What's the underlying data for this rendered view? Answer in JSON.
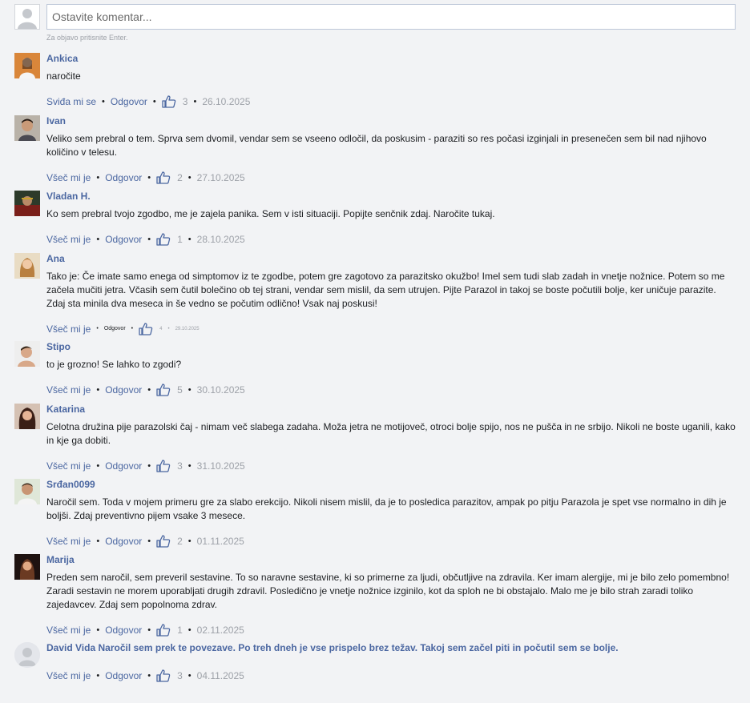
{
  "composer": {
    "placeholder": "Ostavite komentar...",
    "hint": "Za objavo pritisnite Enter."
  },
  "colors": {
    "link": "#4b67a1",
    "muted": "#9da1a8",
    "background": "#f2f3f5"
  },
  "comments": [
    {
      "name": "Ankica",
      "text": "naročite",
      "like_label": "Sviđa mi se",
      "reply_label": "Odgovor",
      "likes": "3",
      "date": "26.10.2025",
      "avatar": "woman-photo-icon"
    },
    {
      "name": "Ivan",
      "text": "Veliko sem prebral o tem. Sprva sem dvomil, vendar sem se vseeno odločil, da poskusim - paraziti so res počasi izginjali in presenečen sem bil nad njihovo količino v telesu.",
      "like_label": "Všeč mi je",
      "reply_label": "Odgovor",
      "likes": "2",
      "date": "27.10.2025",
      "avatar": "man-photo-icon"
    },
    {
      "name": "Vladan H.",
      "text": "Ko sem prebral tvojo zgodbo, me je zajela panika. Sem v isti situaciji. Popijte senčnik zdaj. Naročite tukaj.",
      "like_label": "Všeč mi je",
      "reply_label": "Odgovor",
      "likes": "1",
      "date": "28.10.2025",
      "avatar": "man-photo-icon"
    },
    {
      "name": "Ana",
      "text": "Tako je: Če imate samo enega od simptomov iz te zgodbe, potem gre zagotovo za parazitsko okužbo! Imel sem tudi slab zadah in vnetje nožnice. Potem so me začela mučiti jetra. Včasih sem čutil bolečino ob tej strani, vendar sem mislil, da sem utrujen. Pijte Parazol in takoj se boste počutili bolje, ker uničuje parazite. Zdaj sta minila dva meseca in še vedno se počutim odlično! Vsak naj poskusi!",
      "like_label": "Všeč mi je",
      "reply_label": "Odgovor",
      "likes": "4",
      "date": "29.10.2025",
      "avatar": "woman-photo-icon"
    },
    {
      "name": "Stipo",
      "text": "to je grozno! Se lahko to zgodi?",
      "like_label": "Všeč mi je",
      "reply_label": "Odgovor",
      "likes": "5",
      "date": "30.10.2025",
      "avatar": "man-photo-icon"
    },
    {
      "name": "Katarina",
      "text": "Celotna družina pije parazolski čaj - nimam več slabega zadaha. Moža jetra ne motijoveč, otroci bolje spijo, nos ne pušča in ne srbijo. Nikoli ne boste uganili, kako in kje ga dobiti.",
      "like_label": "Všeč mi je",
      "reply_label": "Odgovor",
      "likes": "3",
      "date": "31.10.2025",
      "avatar": "woman-photo-icon"
    },
    {
      "name": "Srđan0099",
      "text": "Naročil sem. Toda v mojem primeru gre za slabo erekcijo. Nikoli nisem mislil, da je to posledica parazitov, ampak po pitju Parazola je spet vse normalno in dih je boljši. Zdaj preventivno pijem vsake 3 mesece.",
      "like_label": "Všeč mi je",
      "reply_label": "Odgovor",
      "likes": "2",
      "date": "01.11.2025",
      "avatar": "man-photo-icon"
    },
    {
      "name": "Marija",
      "text": "Preden sem naročil, sem preveril sestavine. To so naravne sestavine, ki so primerne za ljudi, občutljive na zdravila. Ker imam alergije, mi je bilo zelo pomembno! Zaradi sestavin ne morem uporabljati drugih zdravil. Posledično je vnetje nožnice izginilo, kot da sploh ne bi obstajalo. Malo me je bilo strah zaradi toliko zajedavcev. Zdaj sem popolnoma zdrav.",
      "like_label": "Všeč mi je",
      "reply_label": "Odgovor",
      "likes": "1",
      "date": "02.11.2025",
      "avatar": "woman-photo-icon"
    },
    {
      "name": "David Vida",
      "text": "Naročil sem prek te povezave. Po treh dneh je vse prispelo brez težav. Takoj sem začel piti in počutil sem se bolje.",
      "like_label": "Všeč mi je",
      "reply_label": "Odgovor",
      "likes": "3",
      "date": "04.11.2025",
      "avatar": "default-user-icon"
    }
  ]
}
